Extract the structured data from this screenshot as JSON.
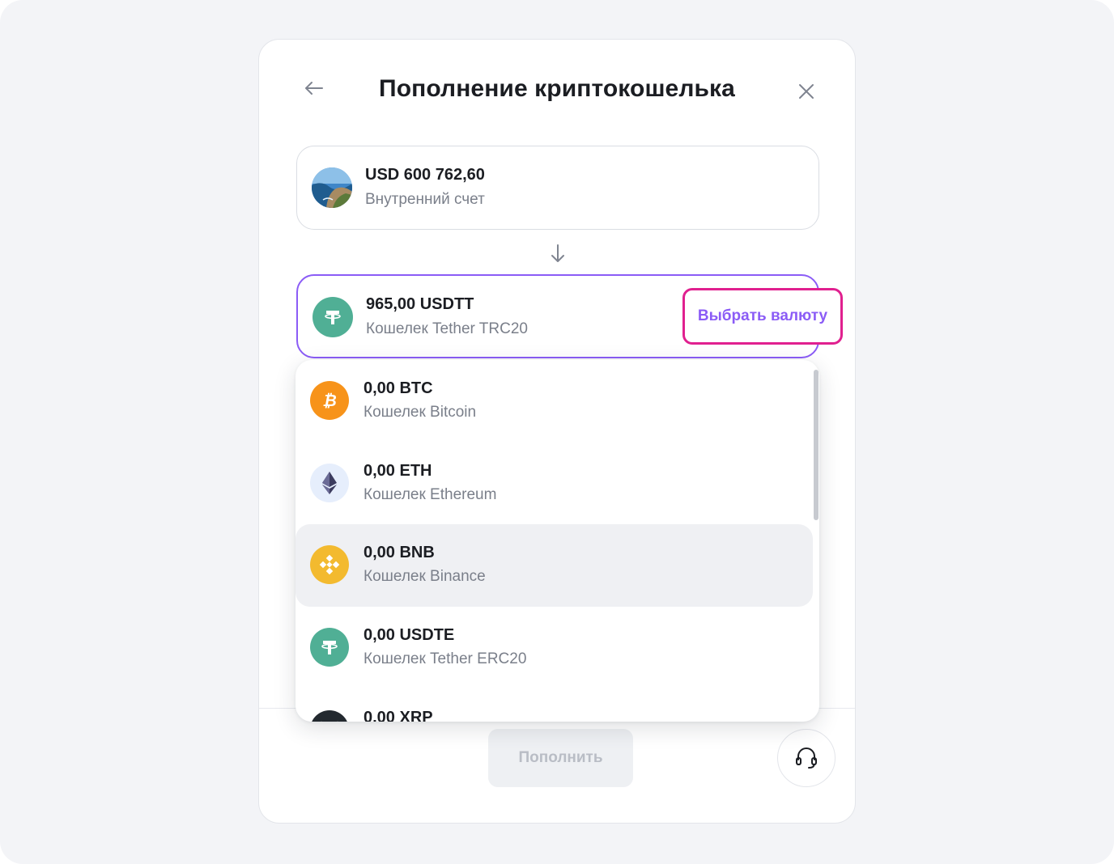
{
  "modal": {
    "title": "Пополнение криптокошелька",
    "back_icon": "arrow-left-icon",
    "close_icon": "close-icon"
  },
  "source_account": {
    "amount": "USD 600 762,60",
    "label": "Внутренний счет",
    "avatar": "landscape-avatar"
  },
  "transfer_icon": "arrow-down-icon",
  "target_wallet": {
    "amount": "965,00 USDTT",
    "label": "Кошелек Tether TRC20",
    "icon": "tether-icon",
    "choose_label": "Выбрать валюту"
  },
  "currency_list": [
    {
      "amount": "0,00 BTC",
      "label": "Кошелек Bitcoin",
      "icon": "bitcoin-icon",
      "color": "#f7931a",
      "active": false
    },
    {
      "amount": "0,00 ETH",
      "label": "Кошелек Ethereum",
      "icon": "ethereum-icon",
      "color": "#e6eefc",
      "active": false
    },
    {
      "amount": "0,00 BNB",
      "label": "Кошелек Binance",
      "icon": "binance-icon",
      "color": "#f3ba2f",
      "active": true
    },
    {
      "amount": "0,00 USDTE",
      "label": "Кошелек Tether ERC20",
      "icon": "tether-icon",
      "color": "#50af95",
      "active": false
    },
    {
      "amount": "0,00 XRP",
      "label": "",
      "icon": "xrp-icon",
      "color": "#23292f",
      "active": false
    }
  ],
  "footer": {
    "topup_label": "Пополнить",
    "support_icon": "headset-icon"
  },
  "colors": {
    "accent": "#8b5cf6",
    "highlight": "#e0208f",
    "tether": "#50af95"
  }
}
